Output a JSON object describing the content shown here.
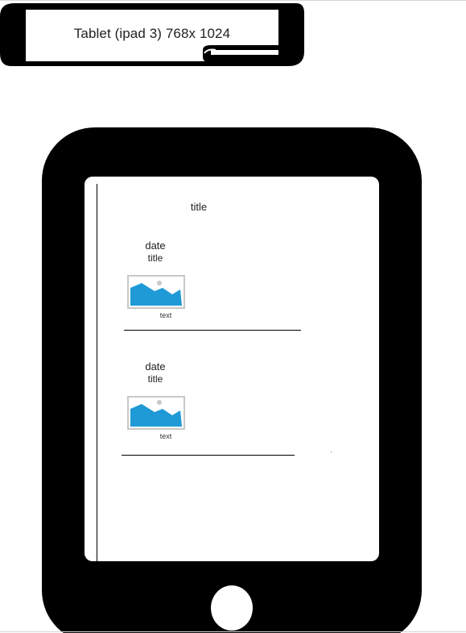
{
  "banner": {
    "label": "Tablet  (ipad 3) 768x 1024"
  },
  "screen": {
    "title": "title",
    "items": [
      {
        "date": "date",
        "title": "title",
        "text": "text"
      },
      {
        "date": "date",
        "title": "title",
        "text": "text"
      }
    ]
  },
  "colors": {
    "device": "#000000",
    "image_sky": "#1f9ad6",
    "image_frame": "#c8c8c8"
  },
  "icons": {
    "image_placeholder": "image-placeholder-icon",
    "home_button": "home-button"
  }
}
